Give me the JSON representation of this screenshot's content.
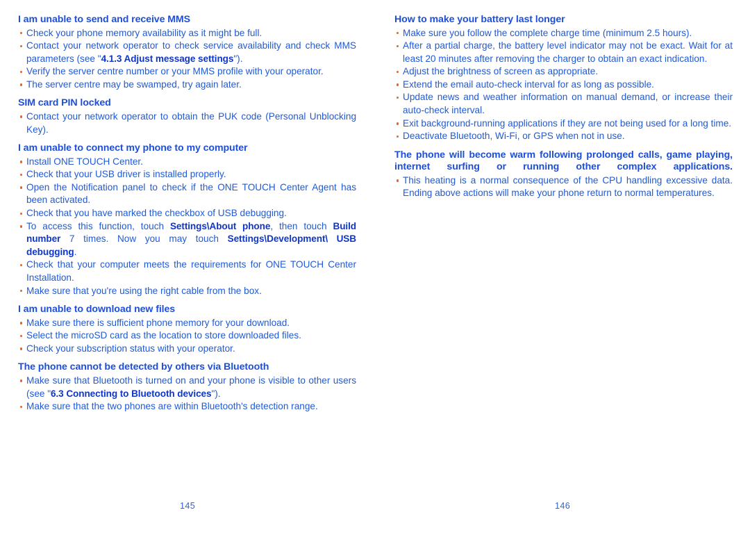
{
  "document": {
    "type": "user-manual-troubleshooting-spread",
    "colors": {
      "heading": "#1d4fd8",
      "body": "#1f5ad8",
      "bullet": "#e8622b",
      "inline_bold": "#1036c8",
      "background": "#ffffff"
    }
  },
  "left_page": {
    "page_number": "145",
    "sections": [
      {
        "heading": "I am unable to send and receive MMS",
        "bullets": [
          {
            "parts": [
              {
                "text": "Check your phone memory availability as it might be full."
              }
            ]
          },
          {
            "parts": [
              {
                "text": "Contact your network operator to check service availability and check MMS parameters (see \""
              },
              {
                "text": "4.1.3 Adjust message settings",
                "bold": true
              },
              {
                "text": "\")."
              }
            ]
          },
          {
            "parts": [
              {
                "text": "Verify the server centre number or your MMS profile with your operator."
              }
            ]
          },
          {
            "parts": [
              {
                "text": "The server centre may be swamped, try again later."
              }
            ]
          }
        ]
      },
      {
        "heading": "SIM card PIN locked",
        "bullets": [
          {
            "parts": [
              {
                "text": "Contact your network operator to obtain the PUK code (Personal Unblocking Key)."
              }
            ]
          }
        ]
      },
      {
        "heading": "I am unable to connect my phone to my computer",
        "bullets": [
          {
            "parts": [
              {
                "text": "Install ONE TOUCH Center."
              }
            ]
          },
          {
            "parts": [
              {
                "text": "Check that your USB driver is installed properly."
              }
            ]
          },
          {
            "parts": [
              {
                "text": "Open the Notification panel to check if the ONE TOUCH Center Agent has been activated."
              }
            ]
          },
          {
            "parts": [
              {
                "text": "Check that you have marked the checkbox of USB debugging."
              }
            ]
          },
          {
            "parts": [
              {
                "text": "To access this function, touch "
              },
              {
                "text": "Settings\\About phone",
                "bold": true
              },
              {
                "text": ", then touch "
              },
              {
                "text": "Build number",
                "bold": true
              },
              {
                "text": " 7 times. Now you may touch "
              },
              {
                "text": "Settings\\Development\\ USB debugging",
                "bold": true
              },
              {
                "text": "."
              }
            ]
          },
          {
            "parts": [
              {
                "text": "Check that your computer meets the requirements for ONE TOUCH Center Installation."
              }
            ]
          },
          {
            "parts": [
              {
                "text": "Make sure that you're using the right cable from the box."
              }
            ]
          }
        ]
      },
      {
        "heading": "I am unable to download new files",
        "bullets": [
          {
            "parts": [
              {
                "text": "Make sure there is sufficient phone memory for your download."
              }
            ]
          },
          {
            "parts": [
              {
                "text": "Select the microSD card as the location to store downloaded files."
              }
            ]
          },
          {
            "parts": [
              {
                "text": "Check your subscription status with your operator."
              }
            ]
          }
        ]
      },
      {
        "heading": "The phone cannot be detected by others via Bluetooth",
        "bullets": [
          {
            "parts": [
              {
                "text": "Make sure that Bluetooth is turned on and your phone is visible to other users (see \""
              },
              {
                "text": "6.3 Connecting to Bluetooth devices",
                "bold": true
              },
              {
                "text": "\")."
              }
            ]
          },
          {
            "parts": [
              {
                "text": "Make sure that the two phones are within Bluetooth's detection range."
              }
            ]
          }
        ]
      }
    ]
  },
  "right_page": {
    "page_number": "146",
    "sections": [
      {
        "heading": "How to make your battery last longer",
        "bullets": [
          {
            "parts": [
              {
                "text": "Make sure you follow the complete charge time (minimum 2.5 hours)."
              }
            ]
          },
          {
            "parts": [
              {
                "text": "After a partial charge, the battery level indicator may not be exact. Wait for at least 20 minutes after removing the charger to obtain an exact indication."
              }
            ]
          },
          {
            "parts": [
              {
                "text": "Adjust the brightness of screen as appropriate."
              }
            ]
          },
          {
            "parts": [
              {
                "text": "Extend the email auto-check interval for as long as possible."
              }
            ]
          },
          {
            "parts": [
              {
                "text": "Update news and weather information on manual demand, or increase their auto-check interval."
              }
            ]
          },
          {
            "parts": [
              {
                "text": "Exit background-running applications if they are not being used for a long time."
              }
            ]
          },
          {
            "parts": [
              {
                "text": "Deactivate Bluetooth, Wi-Fi, or GPS when not in use."
              }
            ]
          }
        ]
      },
      {
        "heading": "The phone will become warm following prolonged calls, game playing, internet surfing or running other complex applications.",
        "heading_justified": true,
        "bullets": [
          {
            "parts": [
              {
                "text": "This heating is a normal consequence of the CPU handling excessive data. Ending above actions will make your phone return to normal temperatures."
              }
            ]
          }
        ]
      }
    ]
  }
}
